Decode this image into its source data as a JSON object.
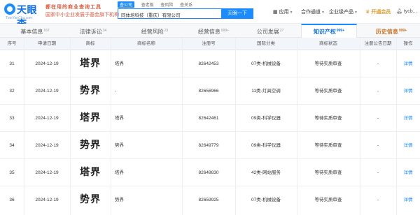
{
  "header": {
    "brand": "天眼查",
    "domain": "TianYanCha.com",
    "slogan1": "都在用的商业查询工具",
    "slogan2": "国家中小企业发展子基金旗下机构",
    "search_tabs": [
      "查公司",
      "查老板",
      "查风险",
      "查关系"
    ],
    "search_value": "同体培科技（重庆）有限公司",
    "search_button": "天眼一下",
    "nav_app": "应用",
    "nav_coop": "合作通道",
    "nav_ent": "企业级产品",
    "nav_vip": "开通会员",
    "nav_user": "tycb..."
  },
  "tabs": [
    {
      "label": "基本信息",
      "count": "167"
    },
    {
      "label": "法律诉讼",
      "count": "34"
    },
    {
      "label": "经营风险",
      "count": "23"
    },
    {
      "label": "经营信息",
      "count": "999+"
    },
    {
      "label": "公司发展",
      "count": "27"
    },
    {
      "label": "知识产权",
      "count": "999+"
    },
    {
      "label": "历史信息",
      "count": "999+"
    }
  ],
  "table": {
    "headers": [
      "序号",
      "申请日期",
      "商标",
      "商标名称",
      "注册号",
      "国际分类",
      "商标状态",
      "注册公告日期",
      "操作"
    ],
    "rows": [
      {
        "no": "31",
        "date": "2024-12-19",
        "mark": "塔界",
        "name": "塔界",
        "reg": "82642453",
        "cls": "07类-机械设备",
        "status": "等待实质审查",
        "notice": "-",
        "action": "详情"
      },
      {
        "no": "32",
        "date": "2024-12-19",
        "mark": "势界",
        "name": "-",
        "reg": "82656966",
        "cls": "11类-灯具空调",
        "status": "等待实质审查",
        "notice": "-",
        "action": "详情"
      },
      {
        "no": "33",
        "date": "2024-12-19",
        "mark": "塔界",
        "name": "塔界",
        "reg": "82642461",
        "cls": "09类-科学仪器",
        "status": "等待实质审查",
        "notice": "-",
        "action": "详情"
      },
      {
        "no": "34",
        "date": "2024-12-19",
        "mark": "势界",
        "name": "势界",
        "reg": "82649779",
        "cls": "09类-科学仪器",
        "status": "等待实质审查",
        "notice": "-",
        "action": "详情"
      },
      {
        "no": "35",
        "date": "2024-12-19",
        "mark": "塔界",
        "name": "塔界",
        "reg": "82649830",
        "cls": "42类-网站服务",
        "status": "等待实质审查",
        "notice": "-",
        "action": "详情"
      },
      {
        "no": "36",
        "date": "2024-12-19",
        "mark": "势界",
        "name": "势界",
        "reg": "82659925",
        "cls": "07类-机械设备",
        "status": "等待实质审查",
        "notice": "-",
        "action": "详情"
      }
    ]
  },
  "colors": {
    "accent": "#1a8cff",
    "brand": "#0a6ee8",
    "history": "#c9711e",
    "vip": "#e09a2a"
  }
}
